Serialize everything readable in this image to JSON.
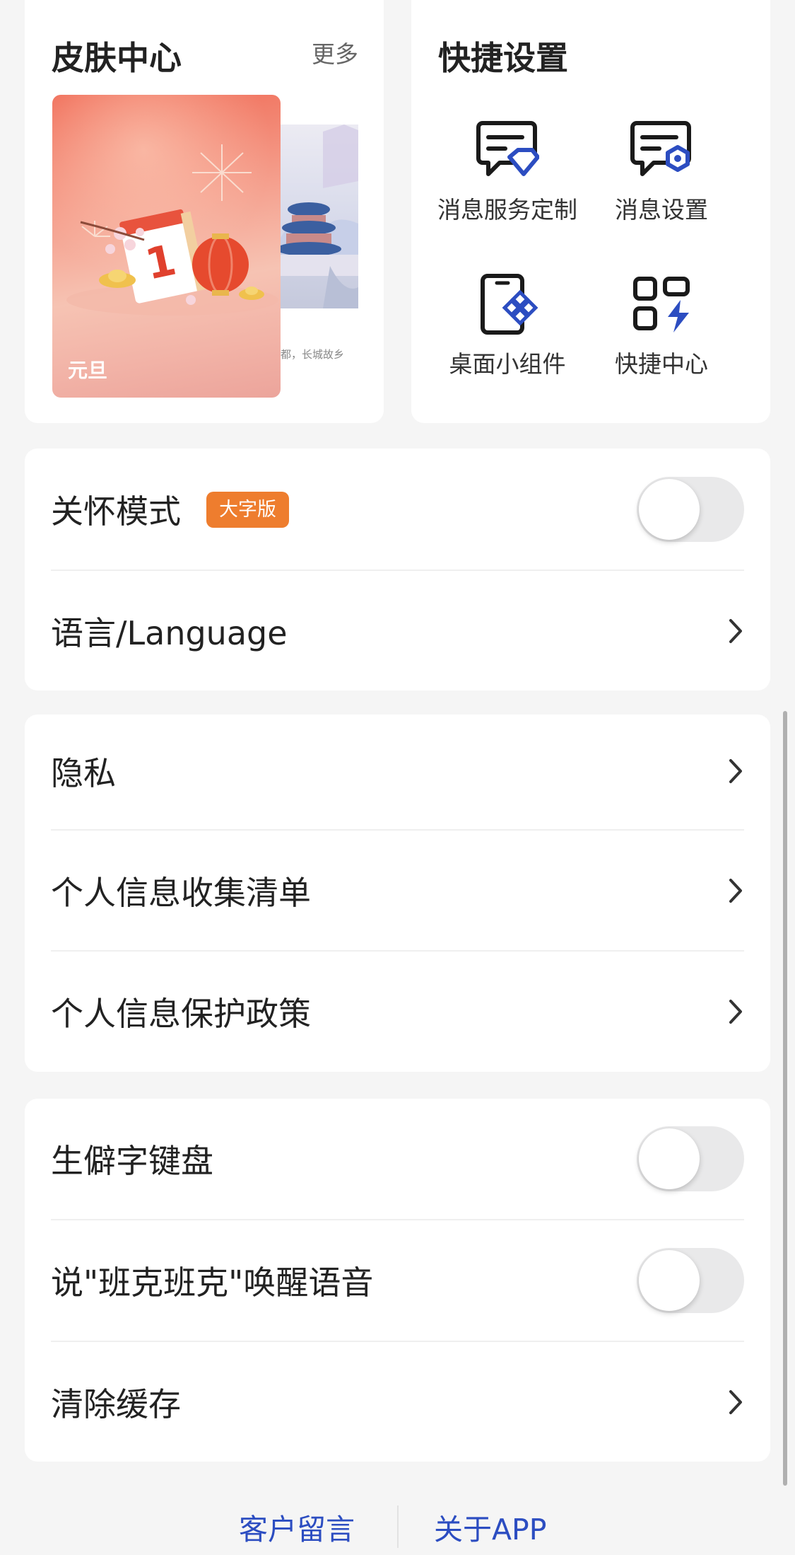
{
  "skin_center": {
    "title": "皮肤中心",
    "more": "更多",
    "current_skin": {
      "label": "元旦"
    },
    "next_skin": {
      "caption": "都，长城故乡"
    }
  },
  "quick_settings": {
    "title": "快捷设置",
    "items": [
      {
        "label": "消息服务定制",
        "icon": "message-service-icon"
      },
      {
        "label": "消息设置",
        "icon": "message-settings-icon"
      },
      {
        "label": "桌面小组件",
        "icon": "desktop-widget-icon"
      },
      {
        "label": "快捷中心",
        "icon": "quick-center-icon"
      }
    ]
  },
  "settings": {
    "care_mode": {
      "label": "关怀模式",
      "badge": "大字版",
      "enabled": false
    },
    "language": {
      "label": "语言/Language"
    },
    "privacy": {
      "label": "隐私"
    },
    "info_collection": {
      "label": "个人信息收集清单"
    },
    "info_protection": {
      "label": "个人信息保护政策"
    },
    "rare_char_keyboard": {
      "label": "生僻字键盘",
      "enabled": false
    },
    "voice_wakeup": {
      "label": "说\"班克班克\"唤醒语音",
      "enabled": false
    },
    "clear_cache": {
      "label": "清除缓存"
    }
  },
  "footer": {
    "feedback": "客户留言",
    "about": "关于APP"
  },
  "colors": {
    "accent": "#2c4dc1",
    "badge": "#ee7d2e",
    "toggle_off": "#e9e9ea"
  }
}
